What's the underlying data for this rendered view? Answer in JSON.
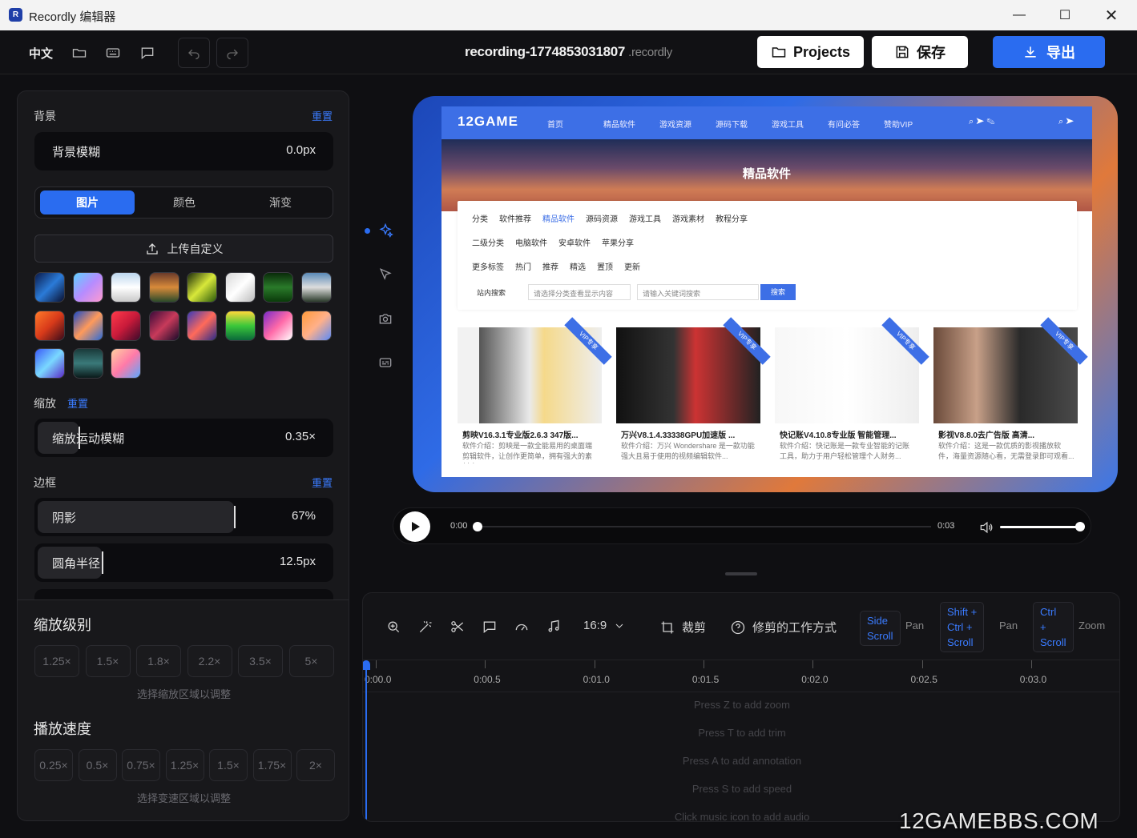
{
  "window": {
    "title": "Recordly 编辑器",
    "app_icon": "recordly-logo-icon"
  },
  "toolbar": {
    "language": "中文",
    "filename": "recording-1774853031807",
    "extension": ".recordly",
    "projects_label": "Projects",
    "save_label": "保存",
    "export_label": "导出"
  },
  "background": {
    "section_label": "背景",
    "reset_label": "重置",
    "blur_label": "背景模糊",
    "blur_value": "0.0px",
    "tabs": [
      "图片",
      "颜色",
      "渐变"
    ],
    "active_tab": 0,
    "upload_label": "上传自定义",
    "wallpaper_count": 19
  },
  "zoom": {
    "section_label": "缩放",
    "reset_label": "重置",
    "motion_blur_label": "缩放运动模糊",
    "motion_blur_value": "0.35×",
    "motion_blur_level": 0.14
  },
  "border": {
    "section_label": "边框",
    "reset_label": "重置",
    "shadow_label": "阴影",
    "shadow_value": "67%",
    "shadow_level": 0.67,
    "radius_label": "圆角半径",
    "radius_value": "12.5px",
    "radius_level": 0.22
  },
  "zoom_level": {
    "title": "缩放级别",
    "options": [
      "1.25×",
      "1.5×",
      "1.8×",
      "2.2×",
      "3.5×",
      "5×"
    ],
    "hint": "选择缩放区域以调整"
  },
  "playback_speed": {
    "title": "播放速度",
    "options": [
      "0.25×",
      "0.5×",
      "0.75×",
      "1.25×",
      "1.5×",
      "1.75×",
      "2×"
    ],
    "hint": "选择变速区域以调整"
  },
  "preview": {
    "site_logo": "12GAME",
    "nav_items": [
      "首页",
      "精品软件",
      "游戏资源",
      "源码下载",
      "游戏工具",
      "有问必答",
      "赞助VIP"
    ],
    "hero_title": "精品软件",
    "filter_rows": [
      [
        "分类",
        "软件推荐",
        "精品软件",
        "源码资源",
        "游戏工具",
        "游戏素材",
        "教程分享"
      ],
      [
        "二级分类",
        "电脑软件",
        "安卓软件",
        "苹果分享"
      ],
      [
        "更多标签",
        "热门",
        "推荐",
        "精选",
        "置顶",
        "更新"
      ]
    ],
    "search_label": "站内搜索",
    "search_select": "请选择分类查看显示内容",
    "search_placeholder": "请输入关键词搜索",
    "search_button": "搜索",
    "cards": [
      {
        "title": "剪映V16.3.1专业版2.6.3 347版...",
        "desc": "软件介绍：剪映是一款全能易用的桌面端剪辑软件，让创作更简单，拥有强大的素材库...",
        "badge": "VIP专享"
      },
      {
        "title": "万兴V8.1.4.33338GPU加速版 ...",
        "desc": "软件介绍：万兴 Wondershare 是一款功能强大且易于使用的视频编辑软件...",
        "badge": "VIP专享"
      },
      {
        "title": "快记账V4.10.8专业版 智能管理...",
        "desc": "软件介绍：快记账是一款专业智能的记账工具，助力于用户轻松管理个人财务...",
        "badge": "VIP专享"
      },
      {
        "title": "影视V8.8.0去广告版 高清...",
        "desc": "软件介绍：这是一款优质的影视播放软件，海量资源随心看，无需登录即可观看...",
        "badge": "VIP专享"
      }
    ]
  },
  "player": {
    "current_time": "0:00",
    "duration": "0:03",
    "progress": 0.0,
    "volume": 1.0
  },
  "timeline": {
    "aspect_ratio": "16:9",
    "crop_label": "裁剪",
    "help_label": "修剪的工作方式",
    "shortcuts": [
      {
        "keys": [
          "Side",
          "Scroll"
        ],
        "action": "Pan"
      },
      {
        "keys": [
          "Shift +",
          "Ctrl +",
          "Scroll"
        ],
        "action": "Pan"
      },
      {
        "keys": [
          "Ctrl",
          "+",
          "Scroll"
        ],
        "action": "Zoom"
      }
    ],
    "ruler_labels": [
      "0:00.0",
      "0:00.5",
      "0:01.0",
      "0:01.5",
      "0:02.0",
      "0:02.5",
      "0:03.0"
    ],
    "hints": [
      "Press Z to add zoom",
      "Press T to add trim",
      "Press A to add annotation",
      "Press S to add speed",
      "Click music icon to add audio"
    ]
  },
  "watermark": "12GAMEBBS.COM"
}
